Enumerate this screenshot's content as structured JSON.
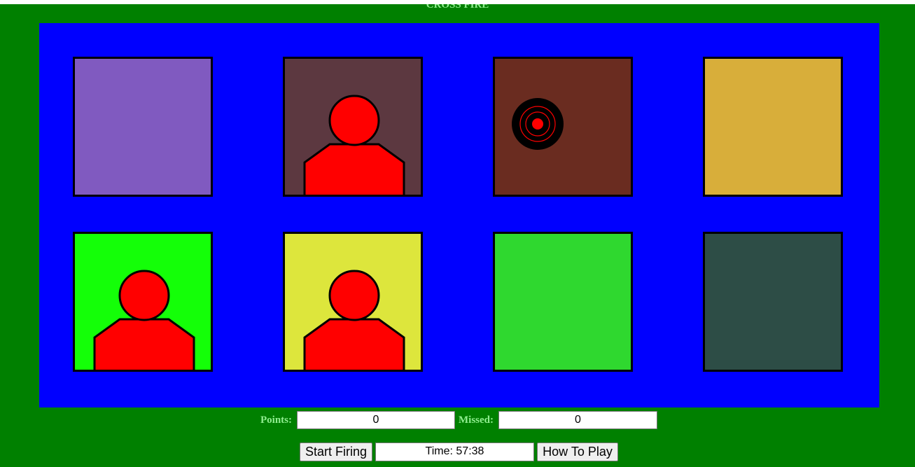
{
  "title": "CROSS FIRE",
  "colors": {
    "background": "#008000",
    "board": "#0000ff",
    "label": "#90ee90",
    "target": "#ff0000"
  },
  "cells": [
    {
      "color": "#805ac0",
      "content": "empty"
    },
    {
      "color": "#5c3840",
      "content": "enemy"
    },
    {
      "color": "#6a2c20",
      "content": "crosshair"
    },
    {
      "color": "#d8ae3a",
      "content": "empty"
    },
    {
      "color": "#14ff08",
      "content": "enemy"
    },
    {
      "color": "#dde63c",
      "content": "enemy"
    },
    {
      "color": "#2fd82f",
      "content": "empty"
    },
    {
      "color": "#2d4d46",
      "content": "empty"
    }
  ],
  "score": {
    "points_label": "Points:",
    "points_value": "0",
    "missed_label": "Missed:",
    "missed_value": "0"
  },
  "controls": {
    "start_label": "Start Firing",
    "time_display": "Time: 57:38",
    "help_label": "How To Play"
  }
}
